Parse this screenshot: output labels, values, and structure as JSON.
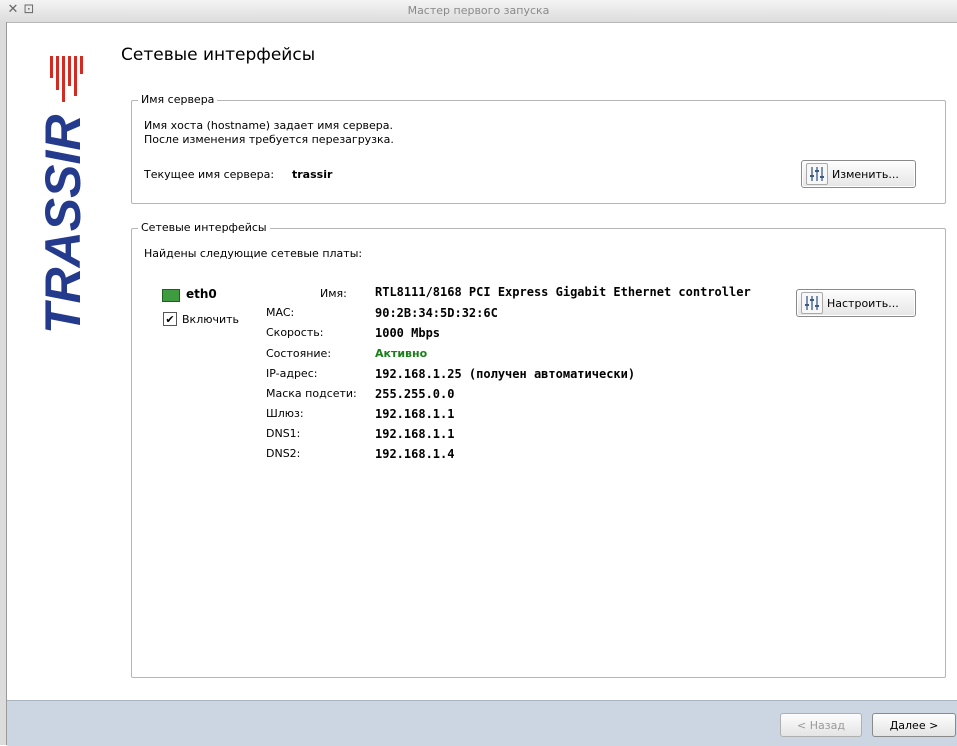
{
  "window": {
    "title": "Мастер первого запуска"
  },
  "brand": {
    "logo_text": "TRASSIR",
    "logo_color": "#243a8c",
    "accent_color": "#d32b22"
  },
  "page": {
    "title": "Сетевые интерфейсы"
  },
  "server_group": {
    "legend": "Имя сервера",
    "line1": "Имя хоста (hostname) задает имя сервера.",
    "line2": "После изменения требуется перезагрузка.",
    "current_label": "Текущее имя сервера:",
    "current_value": "trassir",
    "change_button": "Изменить..."
  },
  "network_group": {
    "legend": "Сетевые интерфейсы",
    "found_text": "Найдены следующие сетевые платы:",
    "interface": {
      "name": "eth0",
      "enable_label": "Включить",
      "enabled": true,
      "configure_button": "Настроить...",
      "name_label": "Имя:",
      "name_value": "RTL8111/8168 PCI Express Gigabit Ethernet controller",
      "fields": [
        {
          "label": "MAC:",
          "value": "90:2B:34:5D:32:6C"
        },
        {
          "label": "Скорость:",
          "value": "1000 Mbps"
        },
        {
          "label": "Состояние:",
          "value": "Активно",
          "color": "#1a7f1a"
        },
        {
          "label": "IP-адрес:",
          "value": "192.168.1.25 (получен автоматически)"
        },
        {
          "label": "Маска подсети:",
          "value": "255.255.0.0"
        },
        {
          "label": "Шлюз:",
          "value": "192.168.1.1"
        },
        {
          "label": "DNS1:",
          "value": "192.168.1.1"
        },
        {
          "label": "DNS2:",
          "value": "192.168.1.4"
        }
      ]
    }
  },
  "footer": {
    "back_button": "< Назад",
    "next_button": "Далее >"
  }
}
